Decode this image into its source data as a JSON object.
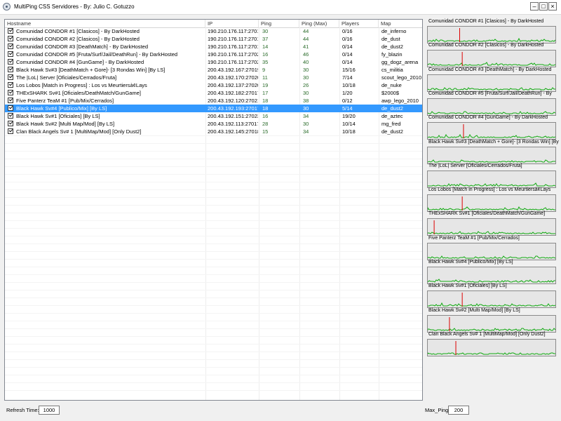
{
  "window": {
    "title": "MultiPing CSS Servidores - By: Julio C. Gotuzzo"
  },
  "columns": [
    "Hostname",
    "IP",
    "Ping",
    "Ping (Max)",
    "Players",
    "Map"
  ],
  "selected_row": 10,
  "rows": [
    {
      "host": "Comunidad CONDOR #1 [Clasicos] - By DarkHosted",
      "ip": "190.210.176.117:27017",
      "ping": "30",
      "ping_max": "44",
      "players": "0/16",
      "map": "de_inferno"
    },
    {
      "host": "Comunidad CONDOR #2 [Clasicos] - By DarkHosted",
      "ip": "190.210.176.117:27018",
      "ping": "37",
      "ping_max": "44",
      "players": "0/16",
      "map": "de_dust"
    },
    {
      "host": "Comunidad CONDOR #3 [DeathMatch] - By DarkHosted",
      "ip": "190.210.176.117:27019",
      "ping": "14",
      "ping_max": "41",
      "players": "0/14",
      "map": "de_dust2"
    },
    {
      "host": "Comunidad CONDOR #5 [Fruta/Surf/Jail/DeathRun] - By DarkHosted",
      "ip": "190.210.176.117:27026",
      "ping": "16",
      "ping_max": "46",
      "players": "0/14",
      "map": "fy_blazin"
    },
    {
      "host": "Comunidad CONDOR #4 [GunGame] - By DarkHosted",
      "ip": "190.210.176.117:27027",
      "ping": "35",
      "ping_max": "40",
      "players": "0/14",
      "map": "gg_dogz_arena"
    },
    {
      "host": "Black Hawk Sv#3 [DeathMatch + Gore]- [3 Rondas Win] [By LS]",
      "ip": "200.43.192.167:27019",
      "ping": "9",
      "ping_max": "30",
      "players": "15/16",
      "map": "cs_militia"
    },
    {
      "host": "The |LoL| Server [Oficiales/Cerrados/Fruta]",
      "ip": "200.43.192.170:27020",
      "ping": "11",
      "ping_max": "30",
      "players": "7/14",
      "map": "scout_lego_2010"
    },
    {
      "host": "Los Lobos [Match in Progress] : Los vs Meurtiersà¢Lays",
      "ip": "200.43.192.137:27020",
      "ping": "19",
      "ping_max": "26",
      "players": "10/18",
      "map": "de_nuke"
    },
    {
      "host": "THExSHARK Sv#1 [Oficiales/DeathMatch/GunGame]",
      "ip": "200.43.192.182:27017",
      "ping": "17",
      "ping_max": "30",
      "players": "1/20",
      "map": "$2000$"
    },
    {
      "host": "Five Panterz TeaM #1 [Pub/Mix/Cerrados]",
      "ip": "200.43.192.120:27021",
      "ping": "18",
      "ping_max": "38",
      "players": "0/12",
      "map": "awp_lego_2010"
    },
    {
      "host": "Black Hawk Sv#4 [Publico/Mix] [By LS]",
      "ip": "200.43.192.193:27017",
      "ping": "18",
      "ping_max": "30",
      "players": "5/14",
      "map": "de_dust2"
    },
    {
      "host": "Black Hawk Sv#1 [Oficiales] [By LS]",
      "ip": "200.43.192.151:27023",
      "ping": "16",
      "ping_max": "34",
      "players": "19/20",
      "map": "de_aztec"
    },
    {
      "host": "Black Hawk Sv#2 [Multi Map/Mod] [By LS]",
      "ip": "200.43.192.113:27017",
      "ping": "28",
      "ping_max": "30",
      "players": "10/14",
      "map": "mg_fred"
    },
    {
      "host": "Clan Black Angels Sv# 1 [MultiMap/Mod] [Only Dust2]",
      "ip": "200.43.192.145:27018",
      "ping": "15",
      "ping_max": "34",
      "players": "10/18",
      "map": "de_dust2"
    }
  ],
  "graphs": [
    {
      "label": "Comunidad CONDOR #1 [Clasicos] - By DarkHosted",
      "spike": 0.25
    },
    {
      "label": "Comunidad CONDOR #2 [Clasicos] - By DarkHosted",
      "spike": 0.27
    },
    {
      "label": "Comunidad CONDOR #3 [DeathMatch] - By DarkHosted",
      "spike": 0
    },
    {
      "label": "Comunidad CONDOR #5 [Fruta/Surf/Jail/DeathRun] - By",
      "spike": 0
    },
    {
      "label": "Comunidad CONDOR #4 [GunGame] - By DarkHosted",
      "spike": 0.28
    },
    {
      "label": "Black Hawk Sv#3 [DeathMatch + Gore]- [3 Rondas Win] [By",
      "spike": 0
    },
    {
      "label": "The |LoL| Server [Oficiales/Cerrados/Fruta]",
      "spike": 0
    },
    {
      "label": "Los Lobos [Match in Progress] : Los vs Meurtiersà¢Lays",
      "spike": 0.27
    },
    {
      "label": "THExSHARK Sv#1 [Oficiales/DeathMatch/GunGame]",
      "spike": 0.05
    },
    {
      "label": "Five Panterz TeaM #1 [Pub/Mix/Cerrados]",
      "spike": 0
    },
    {
      "label": "Black Hawk Sv#4 [Publico/Mix] [By LS]",
      "spike": 0
    },
    {
      "label": "Black Hawk Sv#1 [Oficiales] [By LS]",
      "spike": 0.27
    },
    {
      "label": "Black Hawk Sv#2 [Multi Map/Mod] [By LS]",
      "spike": 0.17
    },
    {
      "label": "Clan Black Angels Sv# 1 [MultiMap/Mod] [Only Dust2]",
      "spike": 0.22
    }
  ],
  "footer": {
    "refresh_label": "Refresh Time:",
    "refresh_value": "1000",
    "maxping_label": "Max_Ping:",
    "maxping_value": "200"
  },
  "colors": {
    "selection": "#3399ff",
    "graph_line": "#11aa11",
    "spike": "#dd0000"
  }
}
